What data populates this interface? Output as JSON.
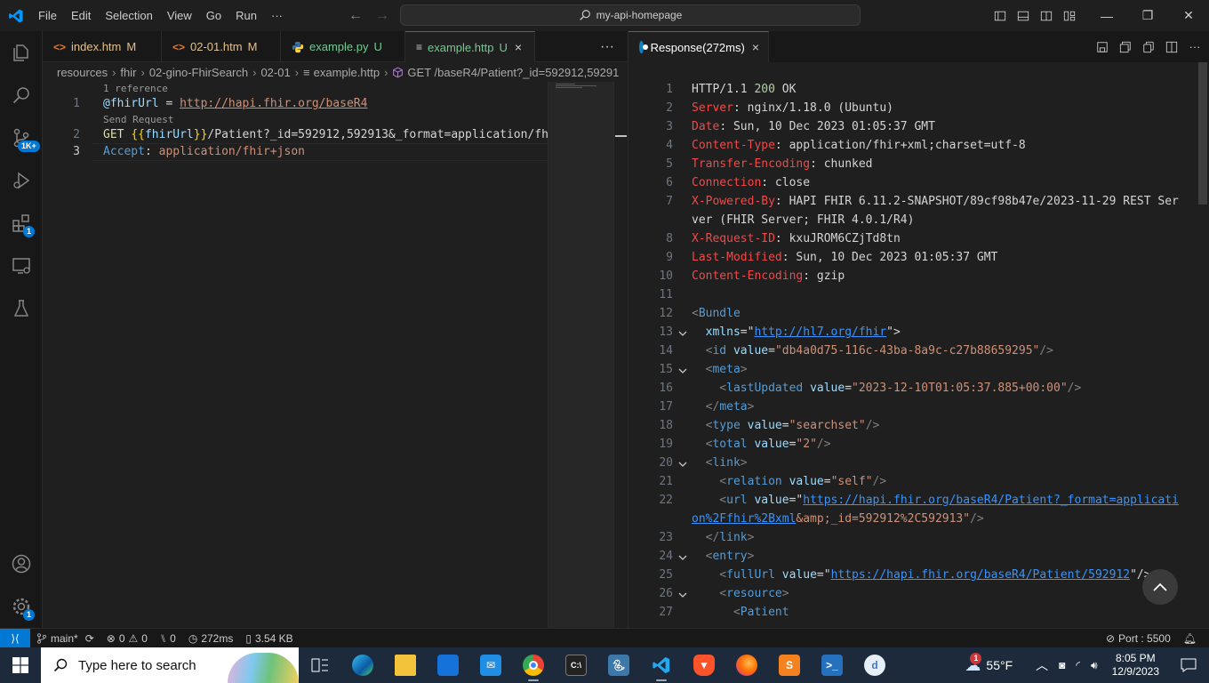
{
  "titlebar": {
    "menu": [
      "File",
      "Edit",
      "Selection",
      "View",
      "Go",
      "Run",
      "···"
    ],
    "search_text": "my-api-homepage"
  },
  "activitybar": {
    "scm_badge": "1K+",
    "extensions_badge": "1",
    "manage_badge": "1"
  },
  "tabs_left": [
    {
      "label": "index.htm",
      "status": "M",
      "icon": "<>",
      "icon_color": "#e37933",
      "status_color": "#e2c08d"
    },
    {
      "label": "02-01.htm",
      "status": "M",
      "icon": "<>",
      "icon_color": "#e37933",
      "status_color": "#e2c08d"
    },
    {
      "label": "example.py",
      "status": "U",
      "icon": "py",
      "icon_color": "#3572a5",
      "status_color": "#73c991"
    },
    {
      "label": "example.http",
      "status": "U",
      "icon": "≡",
      "icon_color": "#cccccc",
      "status_color": "#73c991"
    }
  ],
  "tabs_more": "···",
  "breadcrumb": [
    "resources",
    "fhir",
    "02-gino-FhirSearch",
    "02-01",
    "example.http",
    "GET /baseR4/Patient?_id=592912,59291"
  ],
  "editor_left": {
    "codelens_1": "1 reference",
    "codelens_2": "Send Request",
    "line_numbers": [
      "1",
      "2",
      "3"
    ],
    "line1_var": "@fhirUrl",
    "line1_eq": " = ",
    "line1_url": "http://hapi.fhir.org/baseR4",
    "line2_method": "GET ",
    "line2_brace_open": "{{",
    "line2_var": "fhirUrl",
    "line2_brace_close": "}}",
    "line2_rest": "/Patient?_id=592912,592913&_format=application/fhi",
    "line3_key": "Accept",
    "line3_colon": ": ",
    "line3_value": "application/fhir+json"
  },
  "tab_right": {
    "label": "Response(272ms)",
    "close": "×"
  },
  "response_lines": [
    {
      "n": "1",
      "fold": "",
      "segs": [
        [
          "HTTP/1.1 ",
          "d"
        ],
        [
          "200",
          "status"
        ],
        [
          " OK",
          "d"
        ]
      ]
    },
    {
      "n": "2",
      "fold": "",
      "segs": [
        [
          "Server",
          "red"
        ],
        [
          ": nginx/1.18.0 (Ubuntu)",
          "d"
        ]
      ]
    },
    {
      "n": "3",
      "fold": "",
      "segs": [
        [
          "Date",
          "red"
        ],
        [
          ": Sun, 10 Dec 2023 01:05:37 GMT",
          "d"
        ]
      ]
    },
    {
      "n": "4",
      "fold": "",
      "segs": [
        [
          "Content-Type",
          "red"
        ],
        [
          ": application/fhir+xml;charset=utf-8",
          "d"
        ]
      ]
    },
    {
      "n": "5",
      "fold": "",
      "segs": [
        [
          "Transfer-Encoding",
          "red"
        ],
        [
          ": chunked",
          "d"
        ]
      ]
    },
    {
      "n": "6",
      "fold": "",
      "segs": [
        [
          "Connection",
          "red"
        ],
        [
          ": close",
          "d"
        ]
      ]
    },
    {
      "n": "7",
      "fold": "",
      "segs": [
        [
          "X-Powered-By",
          "red"
        ],
        [
          ": HAPI FHIR 6.11.2-SNAPSHOT/89cf98b47e/2023-11-29 REST Ser",
          "d"
        ]
      ]
    },
    {
      "n": "",
      "fold": "",
      "segs": [
        [
          "ver (FHIR Server; FHIR 4.0.1/R4)",
          "d"
        ]
      ]
    },
    {
      "n": "8",
      "fold": "",
      "segs": [
        [
          "X-Request-ID",
          "red"
        ],
        [
          ": kxuJROM6CZjTd8tn",
          "d"
        ]
      ]
    },
    {
      "n": "9",
      "fold": "",
      "segs": [
        [
          "Last-Modified",
          "red"
        ],
        [
          ": Sun, 10 Dec 2023 01:05:37 GMT",
          "d"
        ]
      ]
    },
    {
      "n": "10",
      "fold": "",
      "segs": [
        [
          "Content-Encoding",
          "red"
        ],
        [
          ": gzip",
          "d"
        ]
      ]
    },
    {
      "n": "11",
      "fold": "",
      "segs": []
    },
    {
      "n": "12",
      "fold": "",
      "segs": [
        [
          "<",
          "gray"
        ],
        [
          "Bundle",
          "tag"
        ]
      ]
    },
    {
      "n": "13",
      "fold": "v",
      "segs": [
        [
          "  ",
          "d"
        ],
        [
          "xmlns",
          "attr"
        ],
        [
          "=\"",
          "d"
        ],
        [
          "http://hl7.org/fhir",
          "link"
        ],
        [
          "\">",
          "d"
        ]
      ]
    },
    {
      "n": "14",
      "fold": "",
      "segs": [
        [
          "  <",
          "gray"
        ],
        [
          "id",
          "tag"
        ],
        [
          " ",
          "d"
        ],
        [
          "value",
          "attr"
        ],
        [
          "=",
          "d"
        ],
        [
          "\"db4a0d75-116c-43ba-8a9c-c27b88659295\"",
          "str"
        ],
        [
          "/>",
          "gray"
        ]
      ]
    },
    {
      "n": "15",
      "fold": "v",
      "segs": [
        [
          "  <",
          "gray"
        ],
        [
          "meta",
          "tag"
        ],
        [
          ">",
          "gray"
        ]
      ]
    },
    {
      "n": "16",
      "fold": "",
      "segs": [
        [
          "    <",
          "gray"
        ],
        [
          "lastUpdated",
          "tag"
        ],
        [
          " ",
          "d"
        ],
        [
          "value",
          "attr"
        ],
        [
          "=",
          "d"
        ],
        [
          "\"2023-12-10T01:05:37.885+00:00\"",
          "str"
        ],
        [
          "/>",
          "gray"
        ]
      ]
    },
    {
      "n": "17",
      "fold": "",
      "segs": [
        [
          "  </",
          "gray"
        ],
        [
          "meta",
          "tag"
        ],
        [
          ">",
          "gray"
        ]
      ]
    },
    {
      "n": "18",
      "fold": "",
      "segs": [
        [
          "  <",
          "gray"
        ],
        [
          "type",
          "tag"
        ],
        [
          " ",
          "d"
        ],
        [
          "value",
          "attr"
        ],
        [
          "=",
          "d"
        ],
        [
          "\"searchset\"",
          "str"
        ],
        [
          "/>",
          "gray"
        ]
      ]
    },
    {
      "n": "19",
      "fold": "",
      "segs": [
        [
          "  <",
          "gray"
        ],
        [
          "total",
          "tag"
        ],
        [
          " ",
          "d"
        ],
        [
          "value",
          "attr"
        ],
        [
          "=",
          "d"
        ],
        [
          "\"2\"",
          "str"
        ],
        [
          "/>",
          "gray"
        ]
      ]
    },
    {
      "n": "20",
      "fold": "v",
      "segs": [
        [
          "  <",
          "gray"
        ],
        [
          "link",
          "tag"
        ],
        [
          ">",
          "gray"
        ]
      ]
    },
    {
      "n": "21",
      "fold": "",
      "segs": [
        [
          "    <",
          "gray"
        ],
        [
          "relation",
          "tag"
        ],
        [
          " ",
          "d"
        ],
        [
          "value",
          "attr"
        ],
        [
          "=",
          "d"
        ],
        [
          "\"self\"",
          "str"
        ],
        [
          "/>",
          "gray"
        ]
      ]
    },
    {
      "n": "22",
      "fold": "",
      "segs": [
        [
          "    <",
          "gray"
        ],
        [
          "url",
          "tag"
        ],
        [
          " ",
          "d"
        ],
        [
          "value",
          "attr"
        ],
        [
          "=\"",
          "d"
        ],
        [
          "https://hapi.fhir.org/baseR4/Patient?_format=applicati",
          "link"
        ]
      ]
    },
    {
      "n": "",
      "fold": "",
      "segs": [
        [
          "on%2Ffhir%2Bxml",
          "link"
        ],
        [
          "&amp;_id=592912%2C592913\"",
          "str"
        ],
        [
          "/>",
          "gray"
        ]
      ]
    },
    {
      "n": "23",
      "fold": "",
      "segs": [
        [
          "  </",
          "gray"
        ],
        [
          "link",
          "tag"
        ],
        [
          ">",
          "gray"
        ]
      ]
    },
    {
      "n": "24",
      "fold": "v",
      "segs": [
        [
          "  <",
          "gray"
        ],
        [
          "entry",
          "tag"
        ],
        [
          ">",
          "gray"
        ]
      ]
    },
    {
      "n": "25",
      "fold": "",
      "segs": [
        [
          "    <",
          "gray"
        ],
        [
          "fullUrl",
          "tag"
        ],
        [
          " ",
          "d"
        ],
        [
          "value",
          "attr"
        ],
        [
          "=\"",
          "d"
        ],
        [
          "https://hapi.fhir.org/baseR4/Patient/592912",
          "link"
        ],
        [
          "\"/>",
          "d"
        ]
      ]
    },
    {
      "n": "26",
      "fold": "v",
      "segs": [
        [
          "    <",
          "gray"
        ],
        [
          "resource",
          "tag"
        ],
        [
          ">",
          "gray"
        ]
      ]
    },
    {
      "n": "27",
      "fold": "",
      "segs": [
        [
          "      <",
          "gray"
        ],
        [
          "Patient",
          "tag"
        ]
      ]
    }
  ],
  "statusbar": {
    "branch": "main*",
    "errors": "0",
    "warnings": "0",
    "ports_forwarded": "0",
    "response_time": "272ms",
    "response_size": "3.54 KB",
    "port": "Port : 5500"
  },
  "taskbar": {
    "search_placeholder": "Type here to search",
    "weather_temp": "55°F",
    "weather_badge": "1",
    "time": "8:05 PM",
    "date": "12/9/2023",
    "notif_badge": "3"
  }
}
